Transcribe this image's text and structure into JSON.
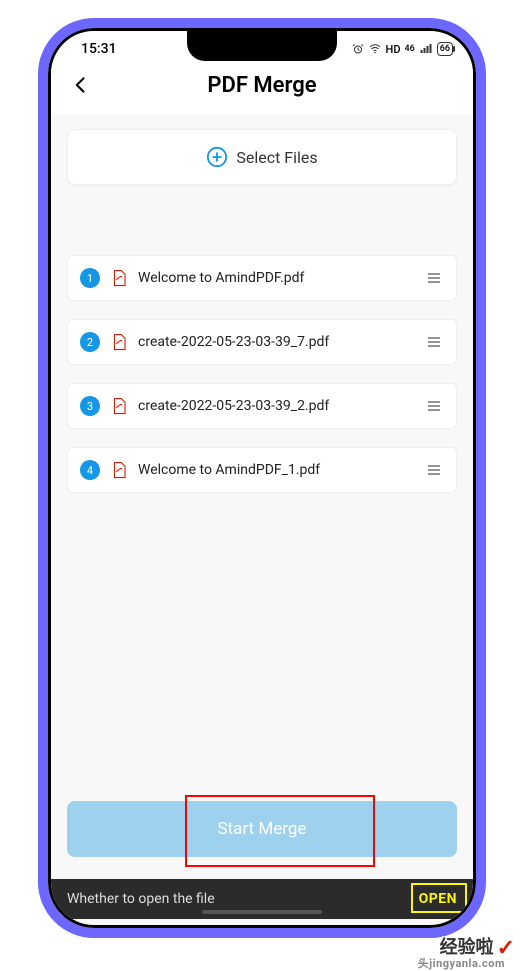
{
  "status": {
    "time": "15:31",
    "indicators": {
      "hd": "HD",
      "net": "46",
      "battery": "66"
    }
  },
  "header": {
    "title": "PDF Merge"
  },
  "select_button": {
    "label": "Select Files"
  },
  "files": [
    {
      "num": "1",
      "name": "Welcome to AmindPDF.pdf"
    },
    {
      "num": "2",
      "name": "create-2022-05-23-03-39_7.pdf"
    },
    {
      "num": "3",
      "name": "create-2022-05-23-03-39_2.pdf"
    },
    {
      "num": "4",
      "name": "Welcome to AmindPDF_1.pdf"
    }
  ],
  "action": {
    "start_merge": "Start Merge"
  },
  "toast": {
    "message": "Whether to open the file",
    "open_label": "OPEN"
  },
  "watermark": {
    "text": "经验啦",
    "check": "✓",
    "url": "头jingyanla.com"
  }
}
